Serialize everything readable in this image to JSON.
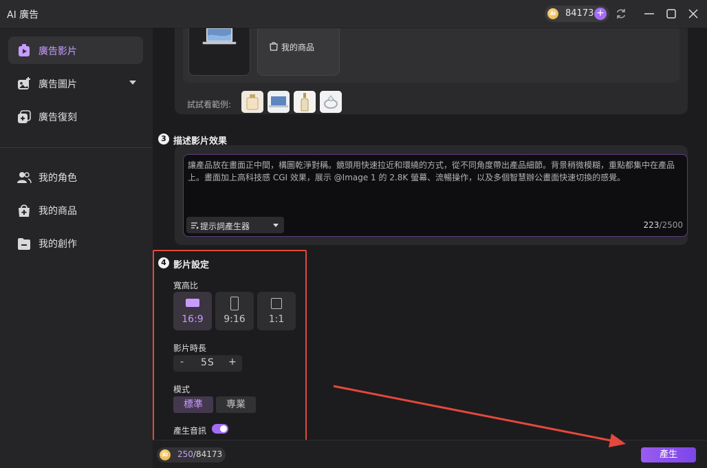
{
  "app": {
    "title": "AI 廣告"
  },
  "titlebar": {
    "credits": "84173",
    "plus": "+"
  },
  "sidebar": {
    "items": [
      {
        "label": "廣告影片",
        "active": true
      },
      {
        "label": "廣告圖片"
      },
      {
        "label": "廣告復刻"
      },
      {
        "label": "我的角色"
      },
      {
        "label": "我的商品"
      },
      {
        "label": "我的創作"
      }
    ]
  },
  "upload": {
    "product_label": "我的商品",
    "examples_label": "試試看範例:"
  },
  "describe": {
    "number": "3",
    "title": "描述影片效果",
    "prompt": "讓產品放在畫面正中間，構圖乾淨對稱。鏡頭用快速拉近和環繞的方式，從不同角度帶出產品細節。背景稍微模糊，重點都集中在產品上。畫面加上高科技感 CGI 效果，展示 @Image 1 的 2.8K 螢幕、流暢操作，以及多個智慧辦公畫面快速切換的感覺。",
    "prompt_generator": "提示詞產生器",
    "char_count": "223",
    "char_max": "/2500"
  },
  "settings": {
    "number": "4",
    "title": "影片設定",
    "aspect_label": "寬高比",
    "ratios": [
      "16:9",
      "9:16",
      "1:1"
    ],
    "duration_label": "影片時長",
    "duration_minus": "-",
    "duration_value": "5S",
    "duration_plus": "+",
    "mode_label": "模式",
    "mode_standard": "標準",
    "mode_pro": "專業",
    "audio_label": "產生音訊",
    "audio_on": true
  },
  "bottom": {
    "cost": "250",
    "cost_total": "/84173",
    "generate": "產生"
  },
  "colors": {
    "accent": "#a56cf5",
    "highlight": "#e5483c"
  },
  "coin_text": "AI"
}
